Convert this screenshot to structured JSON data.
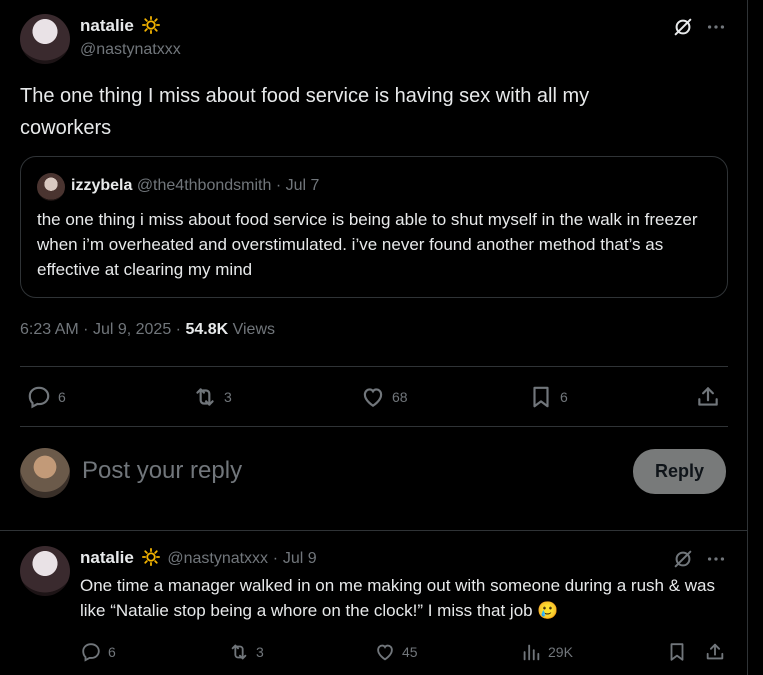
{
  "colors": {
    "background": "#000000",
    "text": "#e7e9ea",
    "muted": "#71767b",
    "border": "#2f3336",
    "reply_button": "#787a7a"
  },
  "main_tweet": {
    "author_name": "natalie",
    "author_badge": "sun-emoji",
    "author_handle": "@nastynatxxx",
    "text": "The one thing I miss about food service is having sex with all my coworkers",
    "quote": {
      "author_name": "izzybela",
      "author_handle": "@the4thbondsmith",
      "separator": "·",
      "date": "Jul 7",
      "text": "the one thing i miss about food service is being able to shut myself in the walk in freezer when i’m overheated and overstimulated. i’ve never found another method that’s as effective at clearing my mind"
    },
    "meta": {
      "time": "6:23 AM",
      "dot": "·",
      "date": "Jul 9, 2025",
      "dot2": "·",
      "views_count": "54.8K",
      "views_label": "Views"
    },
    "actions": {
      "replies": "6",
      "reposts": "3",
      "likes": "68",
      "bookmarks": "6"
    }
  },
  "reply_box": {
    "placeholder": "Post your reply",
    "button_label": "Reply"
  },
  "reply_tweet": {
    "author_name": "natalie",
    "author_handle": "@nastynatxxx",
    "separator": "·",
    "date": "Jul 9",
    "text": "One time a manager walked in on me making out with someone during a rush & was like “Natalie stop being a whore on the clock!” I miss that job",
    "emoji": "🥲",
    "actions": {
      "replies": "6",
      "reposts": "3",
      "likes": "45",
      "views": "29K"
    }
  }
}
